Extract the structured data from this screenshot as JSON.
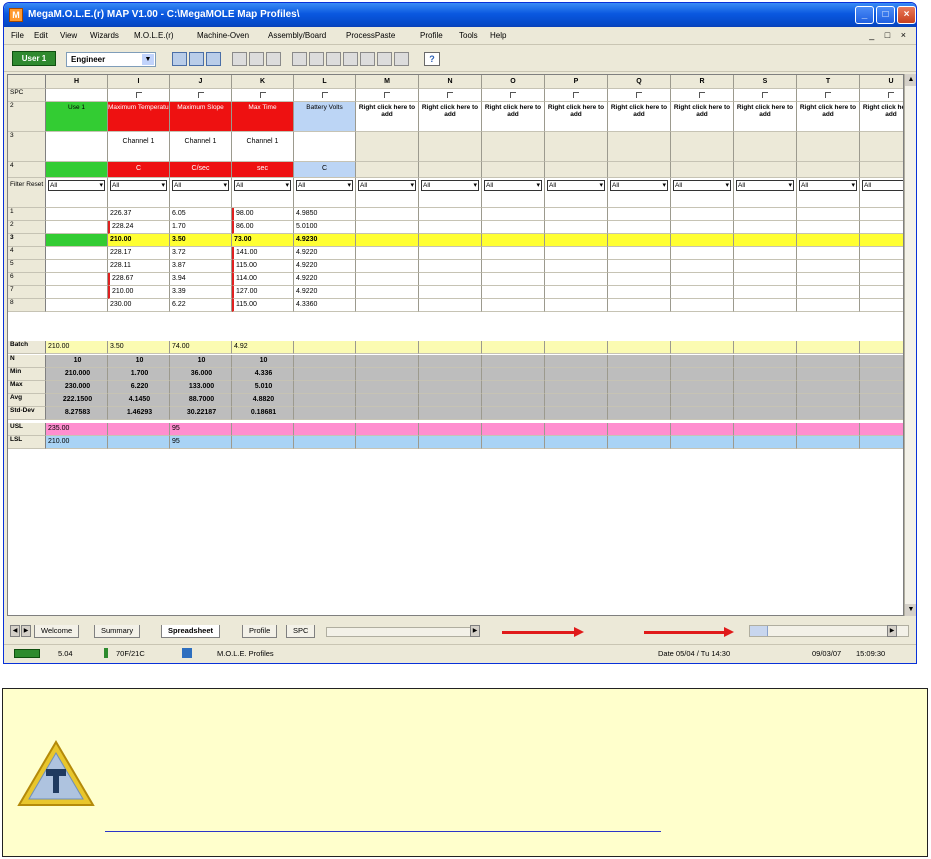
{
  "window": {
    "title": "MegaM.O.L.E.(r) MAP V1.00 - C:\\MegaMOLE Map Profiles\\",
    "app_icon": "M",
    "controls": {
      "minimize": "_",
      "maximize": "□",
      "close": "×"
    }
  },
  "menu": [
    "File",
    "Edit",
    "View",
    "Wizards",
    "M.O.L.E.(r)",
    "Machine-Oven",
    "Assembly/Board",
    "ProcessPaste",
    "Profile",
    "Tools",
    "Help"
  ],
  "mdi_controls": "_ □ ×",
  "toolbar": {
    "user_button": "User 1",
    "role_value": "Engineer",
    "help_icon": "?"
  },
  "grid": {
    "columns": [
      "H",
      "I",
      "J",
      "K",
      "L",
      "M",
      "N",
      "O",
      "P",
      "Q",
      "R",
      "S",
      "T",
      "U"
    ],
    "row_labels": {
      "spc": "SPC",
      "r2": "2",
      "r3": "3",
      "r4": "4",
      "filter": "Filter Reset",
      "data": [
        "1",
        "2",
        "3",
        "4",
        "5",
        "6",
        "7",
        "8"
      ],
      "stats": [
        "Batch",
        "N",
        "Min",
        "Max",
        "Avg",
        "Std-Dev",
        "USL",
        "LSL"
      ]
    },
    "header_cells": {
      "h": "Use 1",
      "i": "Maximum Temperature",
      "j": "Maximum Slope",
      "k": "Max Time",
      "l": "Battery Volts",
      "rest": "Right click here to add"
    },
    "channel_row": [
      "Channel 1",
      "Channel 1",
      "Channel 1"
    ],
    "unit_row": [
      "C",
      "C/sec",
      "sec",
      "C"
    ],
    "filter_value": "All",
    "data_rows": [
      [
        "",
        "226.37",
        "6.05",
        "98.00",
        "4.9850"
      ],
      [
        "",
        "228.24",
        "1.70",
        "86.00",
        "5.0100"
      ],
      [
        "",
        "210.00",
        "3.50",
        "73.00",
        "4.9230"
      ],
      [
        "",
        "228.17",
        "3.72",
        "141.00",
        "4.9220"
      ],
      [
        "",
        "228.11",
        "3.87",
        "115.00",
        "4.9220"
      ],
      [
        "",
        "228.67",
        "3.94",
        "114.00",
        "4.9220"
      ],
      [
        "",
        "210.00",
        "3.39",
        "127.00",
        "4.9220"
      ],
      [
        "",
        "230.00",
        "6.22",
        "115.00",
        "4.3360"
      ]
    ],
    "batch_row": [
      "210.00",
      "3.50",
      "74.00",
      "4.92"
    ],
    "n_row": [
      "10",
      "10",
      "10",
      "10"
    ],
    "min_row": [
      "210.000",
      "1.700",
      "36.000",
      "4.336"
    ],
    "max_row": [
      "230.000",
      "6.220",
      "133.000",
      "5.010"
    ],
    "avg_row": [
      "222.1500",
      "4.1450",
      "88.7000",
      "4.8820"
    ],
    "std_row": [
      "8.27583",
      "1.46293",
      "30.22187",
      "0.18681"
    ],
    "usl_row": [
      "235.00",
      "95"
    ],
    "lsl_row": [
      "210.00",
      "95"
    ]
  },
  "sheet_tabs": [
    "Welcome",
    "Summary",
    "Spreadsheet",
    "Profile",
    "SPC"
  ],
  "active_tab": "Spreadsheet",
  "status": {
    "battery": "5.04",
    "temp": "70F/21C",
    "mode": "M.O.L.E. Profiles",
    "datetime": "Date 05/04 / Tu 14:30",
    "date": "09/03/07",
    "time": "15:09:30"
  },
  "colors": {
    "title_blue": "#0a58e0",
    "header_green": "#33cc33",
    "header_red": "#ee1111",
    "battery_blue": "#bcd5f5",
    "highlight_yellow": "#ffff33",
    "usl_pink": "#ff8ecf",
    "lsl_blue": "#a9d3f5",
    "arrow_red": "#e01a1a"
  },
  "note": {
    "icon": "caution-hammer-icon",
    "link_text": ""
  }
}
